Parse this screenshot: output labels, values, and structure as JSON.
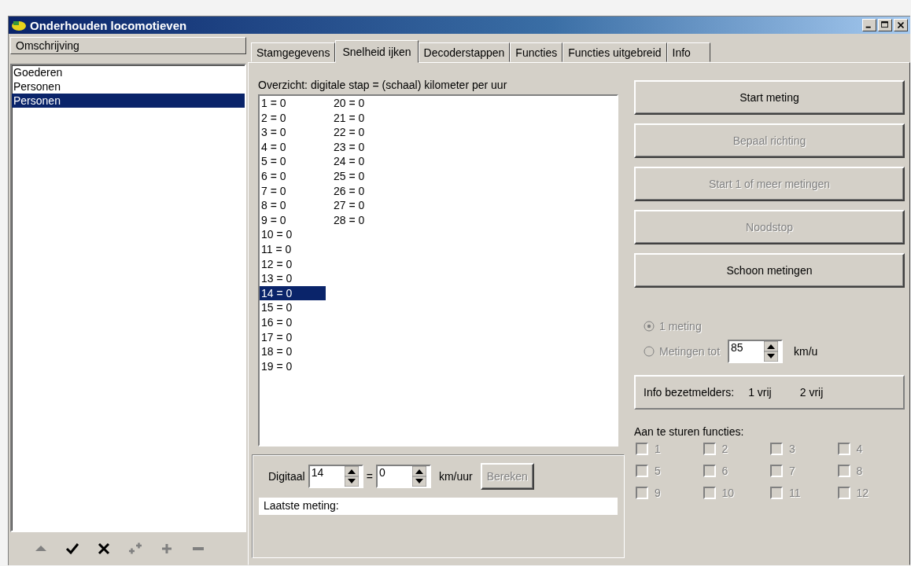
{
  "window": {
    "title": "Onderhouden locomotieven"
  },
  "sidebar": {
    "header": "Omschrijving",
    "items": [
      {
        "label": "Goederen",
        "selected": false
      },
      {
        "label": "Personen",
        "selected": false
      },
      {
        "label": "Personen",
        "selected": true
      }
    ],
    "tools": [
      {
        "kind": "up",
        "disabled": true
      },
      {
        "kind": "check",
        "disabled": false
      },
      {
        "kind": "cross",
        "disabled": false
      },
      {
        "kind": "double-plus",
        "disabled": true
      },
      {
        "kind": "plus",
        "disabled": true
      },
      {
        "kind": "minus",
        "disabled": true
      }
    ]
  },
  "tabs": [
    {
      "label": "Stamgegevens",
      "selected": false
    },
    {
      "label": "Snelheid ijken",
      "selected": true
    },
    {
      "label": "Decoderstappen",
      "selected": false
    },
    {
      "label": "Functies",
      "selected": false
    },
    {
      "label": "Functies uitgebreid",
      "selected": false
    },
    {
      "label": "Info",
      "selected": false
    }
  ],
  "speed_page": {
    "overview_label": "Overzicht: digitale stap = (schaal) kilometer per uur",
    "steps": [
      {
        "label": "1 = 0",
        "selected": false
      },
      {
        "label": "2 = 0",
        "selected": false
      },
      {
        "label": "3 = 0",
        "selected": false
      },
      {
        "label": "4 = 0",
        "selected": false
      },
      {
        "label": "5 = 0",
        "selected": false
      },
      {
        "label": "6 = 0",
        "selected": false
      },
      {
        "label": "7 = 0",
        "selected": false
      },
      {
        "label": "8 = 0",
        "selected": false
      },
      {
        "label": "9 = 0",
        "selected": false
      },
      {
        "label": "10 = 0",
        "selected": false
      },
      {
        "label": "11 = 0",
        "selected": false
      },
      {
        "label": "12 = 0",
        "selected": false
      },
      {
        "label": "13 = 0",
        "selected": false
      },
      {
        "label": "14 = 0",
        "selected": true
      },
      {
        "label": "15 = 0",
        "selected": false
      },
      {
        "label": "16 = 0",
        "selected": false
      },
      {
        "label": "17 = 0",
        "selected": false
      },
      {
        "label": "18 = 0",
        "selected": false
      },
      {
        "label": "19 = 0",
        "selected": false
      },
      {
        "label": "20 = 0",
        "selected": false
      },
      {
        "label": "21 = 0",
        "selected": false
      },
      {
        "label": "22 = 0",
        "selected": false
      },
      {
        "label": "23 = 0",
        "selected": false
      },
      {
        "label": "24 = 0",
        "selected": false
      },
      {
        "label": "25 = 0",
        "selected": false
      },
      {
        "label": "26 = 0",
        "selected": false
      },
      {
        "label": "27 = 0",
        "selected": false
      },
      {
        "label": "28 = 0",
        "selected": false
      }
    ],
    "calc": {
      "label": "Digitaal",
      "step_value": "14",
      "equals": "=",
      "speed_value": "0",
      "unit": "km/uur",
      "button": {
        "label": "Bereken",
        "disabled": true
      }
    },
    "last_measurement": "Laatste meting:",
    "actions": [
      {
        "label": "Start meting",
        "disabled": false
      },
      {
        "label": "Bepaal richting",
        "disabled": true
      },
      {
        "label": "Start 1 of meer metingen",
        "disabled": true
      },
      {
        "label": "Noodstop",
        "disabled": true
      },
      {
        "label": "Schoon metingen",
        "disabled": false
      }
    ],
    "modes": [
      {
        "kind": "plain",
        "label": "1 meting",
        "selected": true,
        "disabled": true
      },
      {
        "kind": "limit",
        "label": "Metingen tot",
        "selected": false,
        "disabled": true,
        "value": "85",
        "unit": "km/u"
      }
    ],
    "info": {
      "label": "Info bezetmelders:",
      "detector_1": "1 vrij",
      "detector_2": "2 vrij"
    },
    "functions_label": "Aan te sturen functies:",
    "functions": [
      {
        "label": "1",
        "checked": false,
        "disabled": true
      },
      {
        "label": "2",
        "checked": false,
        "disabled": true
      },
      {
        "label": "3",
        "checked": false,
        "disabled": true
      },
      {
        "label": "4",
        "checked": false,
        "disabled": true
      },
      {
        "label": "5",
        "checked": false,
        "disabled": true
      },
      {
        "label": "6",
        "checked": false,
        "disabled": true
      },
      {
        "label": "7",
        "checked": false,
        "disabled": true
      },
      {
        "label": "8",
        "checked": false,
        "disabled": true
      },
      {
        "label": "9",
        "checked": false,
        "disabled": true
      },
      {
        "label": "10",
        "checked": false,
        "disabled": true
      },
      {
        "label": "11",
        "checked": false,
        "disabled": true
      },
      {
        "label": "12",
        "checked": false,
        "disabled": true
      }
    ]
  }
}
